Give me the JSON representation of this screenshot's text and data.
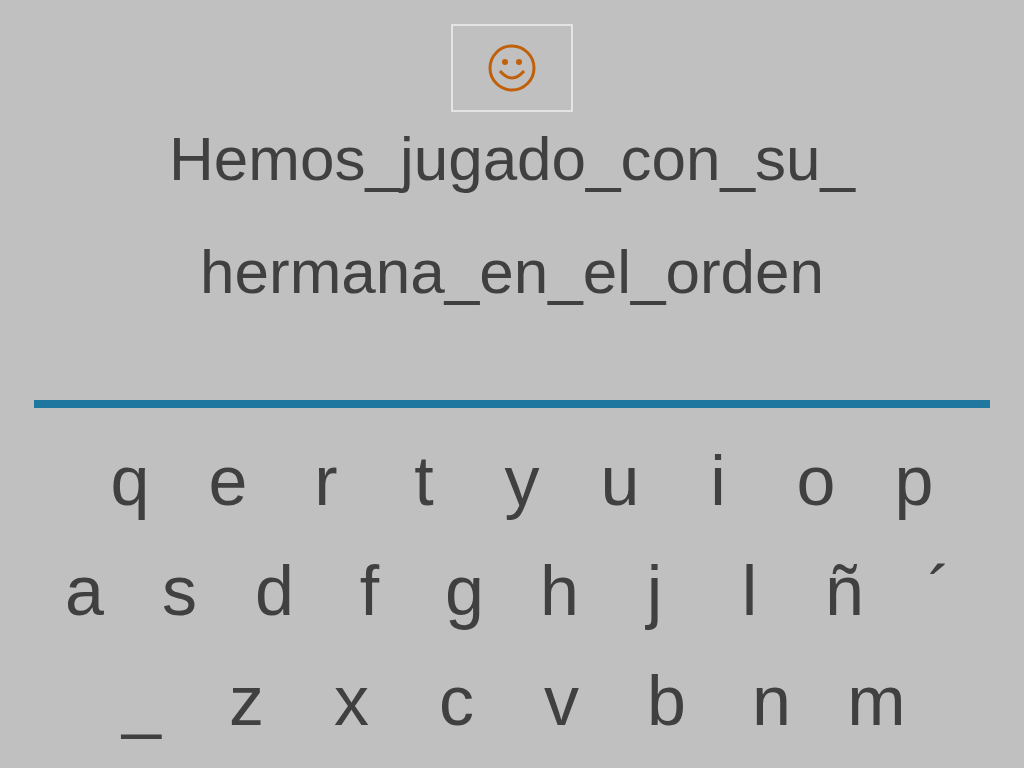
{
  "phrase_lines": [
    "Hemos_jugado_con_su_",
    "hermana_en_el_orden"
  ],
  "keyboard_rows": [
    [
      "q",
      "e",
      "r",
      "t",
      "y",
      "u",
      "i",
      "o",
      "p"
    ],
    [
      "a",
      "s",
      "d",
      "f",
      "g",
      "h",
      "j",
      "l",
      "ñ",
      "´"
    ],
    [
      "_",
      "z",
      "x",
      "c",
      "v",
      "b",
      "n",
      "m"
    ]
  ]
}
